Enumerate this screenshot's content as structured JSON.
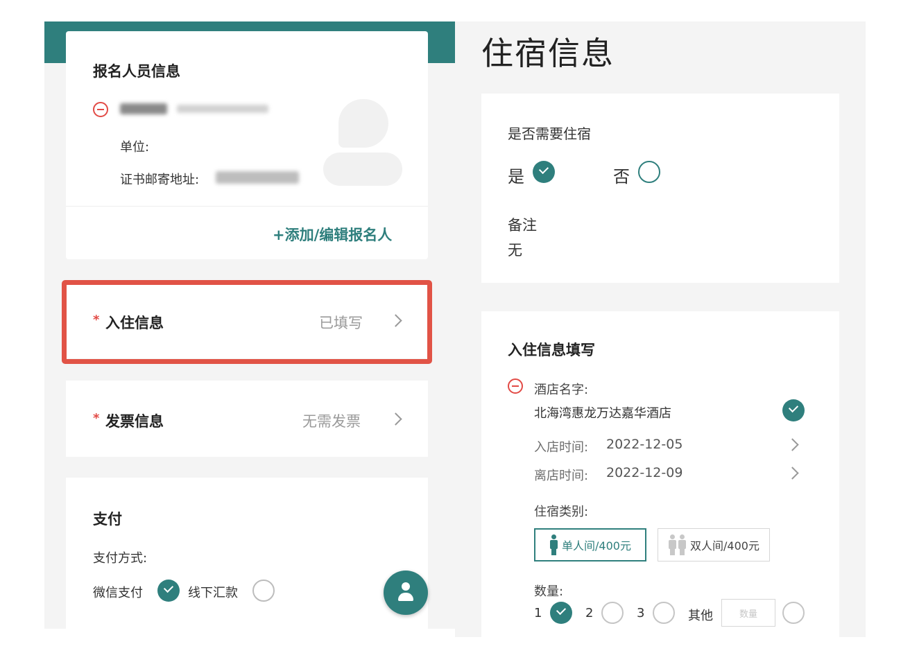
{
  "left": {
    "registrant": {
      "title": "报名人员信息",
      "unit_label": "单位:",
      "address_label": "证书邮寄地址:",
      "add_edit_label": "+添加/编辑报名人"
    },
    "checkin_row": {
      "label": "入住信息",
      "status": "已填写",
      "required_mark": "*"
    },
    "invoice_row": {
      "label": "发票信息",
      "status": "无需发票",
      "required_mark": "*"
    },
    "payment": {
      "title": "支付",
      "method_label": "支付方式:",
      "options": [
        {
          "label": "微信支付",
          "selected": true
        },
        {
          "label": "线下汇款",
          "selected": false
        }
      ]
    }
  },
  "right": {
    "page_title": "住宿信息",
    "need_lodging": {
      "question": "是否需要住宿",
      "yes_label": "是",
      "no_label": "否",
      "selected": "是"
    },
    "remark": {
      "label": "备注",
      "value": "无"
    },
    "checkin_form": {
      "title": "入住信息填写",
      "hotel_label": "酒店名字:",
      "hotel_name": "北海湾惠龙万达嘉华酒店",
      "checkin_label": "入店时间:",
      "checkin_date": "2022-12-05",
      "checkout_label": "离店时间:",
      "checkout_date": "2022-12-09",
      "room_type_label": "住宿类别:",
      "room_types": [
        {
          "label": "单人间/400元",
          "selected": true
        },
        {
          "label": "双人间/400元",
          "selected": false
        }
      ],
      "quantity_label": "数量:",
      "quantity_options": [
        "1",
        "2",
        "3",
        "其他"
      ],
      "quantity_selected": "1",
      "quantity_placeholder": "数量"
    }
  },
  "colors": {
    "accent": "#2f7f7d",
    "highlight": "#e15346",
    "required": "#e24a45"
  }
}
